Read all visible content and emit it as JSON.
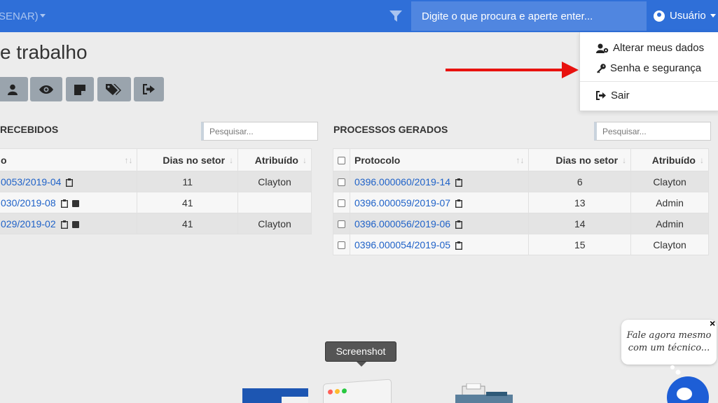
{
  "navbar": {
    "brand_fragment": "SENAR)",
    "search_placeholder": "Digite o que procura e aperte enter...",
    "user_label": "Usuário"
  },
  "user_dropdown": {
    "items": [
      {
        "label": "Alterar meus dados",
        "icon": "user-gear-icon"
      },
      {
        "label": "Senha e segurança",
        "icon": "key-icon"
      },
      {
        "label": "Sair",
        "icon": "sign-out-icon"
      }
    ]
  },
  "page": {
    "title": "e trabalho"
  },
  "toolbar": {
    "buttons": [
      {
        "icon": "user-icon"
      },
      {
        "icon": "eye-icon"
      },
      {
        "icon": "sticky-note-icon"
      },
      {
        "icon": "tags-icon"
      },
      {
        "icon": "sign-out-icon"
      }
    ]
  },
  "received": {
    "title": "RECEBIDOS",
    "search_placeholder": "Pesquisar...",
    "columns": [
      "o",
      "Dias no setor",
      "Atribuído"
    ],
    "rows": [
      {
        "protocol": "0053/2019-04",
        "days": "11",
        "assigned": "Clayton",
        "has_note": false
      },
      {
        "protocol": "030/2019-08",
        "days": "41",
        "assigned": "",
        "has_note": true
      },
      {
        "protocol": "029/2019-02",
        "days": "41",
        "assigned": "Clayton",
        "has_note": true
      }
    ]
  },
  "generated": {
    "title": "PROCESSOS GERADOS",
    "search_placeholder": "Pesquisar...",
    "columns": [
      "Protocolo",
      "Dias no setor",
      "Atribuído"
    ],
    "rows": [
      {
        "protocol": "0396.000060/2019-14",
        "days": "6",
        "assigned": "Clayton"
      },
      {
        "protocol": "0396.000059/2019-07",
        "days": "13",
        "assigned": "Admin"
      },
      {
        "protocol": "0396.000056/2019-06",
        "days": "14",
        "assigned": "Admin"
      },
      {
        "protocol": "0396.000054/2019-05",
        "days": "15",
        "assigned": "Clayton"
      }
    ]
  },
  "tooltip": {
    "label": "Screenshot"
  },
  "chat": {
    "line1": "Fale agora mesmo",
    "line2": "com um técnico...",
    "close": "×"
  },
  "colors": {
    "navbar": "#2f6fd8",
    "link": "#1f62c8",
    "arrow": "#e8120f",
    "tool_button": "#9aa4ad"
  }
}
